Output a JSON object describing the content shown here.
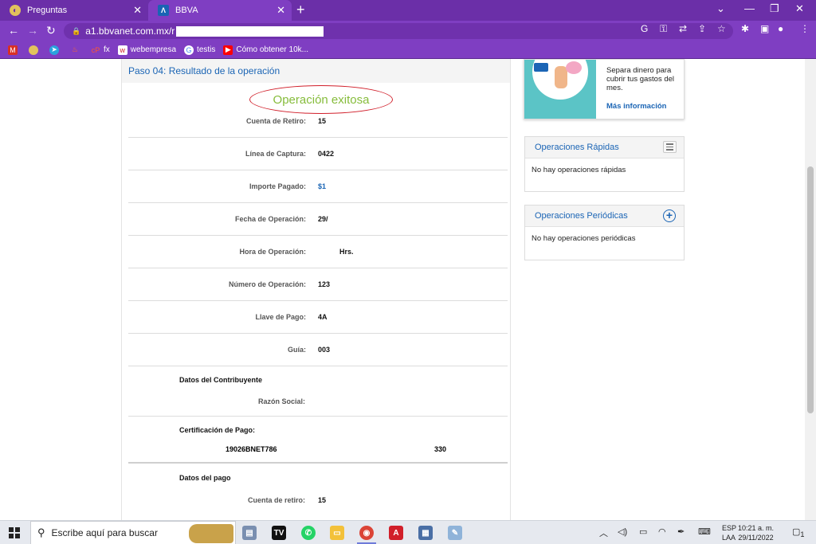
{
  "browser": {
    "tabs": [
      {
        "title": "Preguntas",
        "icon": "egg-icon"
      },
      {
        "title": "BBVA",
        "icon": "bbva-icon"
      }
    ],
    "url": "a1.bbvanet.com.mx/r",
    "bookmarks": [
      {
        "label": "",
        "icon": "mail-icon"
      },
      {
        "label": "",
        "icon": "egg-icon"
      },
      {
        "label": "",
        "icon": "telegram-icon"
      },
      {
        "label": "",
        "icon": "fire-icon"
      },
      {
        "label": "fx",
        "icon": "cp-icon"
      },
      {
        "label": "webempresa",
        "icon": "webempresa-icon"
      },
      {
        "label": "testis",
        "icon": "google-icon"
      },
      {
        "label": "Cómo obtener 10k...",
        "icon": "youtube-icon"
      }
    ]
  },
  "step": {
    "title": "Paso 04: Resultado de la operación",
    "success": "Operación exitosa"
  },
  "fields": [
    {
      "label": "Cuenta de Retiro:",
      "value": "15"
    },
    {
      "label": "Línea de Captura:",
      "value": "0422"
    },
    {
      "label": "Importe Pagado:",
      "value": "$1"
    },
    {
      "label": "Fecha de Operación:",
      "value": "29/"
    },
    {
      "label": "Hora de Operación:",
      "value": "Hrs."
    },
    {
      "label": "Número de Operación:",
      "value": "123"
    },
    {
      "label": "Llave de Pago:",
      "value": "4A"
    },
    {
      "label": "Guía:",
      "value": "003"
    }
  ],
  "contribuyente": {
    "title": "Datos del Contribuyente",
    "razon_label": "Razón Social:"
  },
  "certificacion": {
    "title": "Certificación de Pago:",
    "code": "19026BNET786",
    "number": "330"
  },
  "datos_pago": {
    "title": "Datos del pago",
    "cuenta_label": "Cuenta de retiro:",
    "cuenta_value": "15"
  },
  "promo": {
    "text": "Separa dinero para cubrir tus gastos del mes.",
    "link": "Más información"
  },
  "rapidas": {
    "title": "Operaciones Rápidas",
    "empty": "No hay operaciones rápidas"
  },
  "periodicas": {
    "title": "Operaciones Periódicas",
    "empty": "No hay operaciones periódicas"
  },
  "taskbar": {
    "search_placeholder": "Escribe aquí para buscar",
    "lang_top": "ESP",
    "lang_bottom": "LAA",
    "time": "10:21 a. m.",
    "date": "29/11/2022",
    "notif_count": "1"
  },
  "colors": {
    "browser_purple": "#7f3ec2",
    "bbva_blue": "#1b65b5",
    "success_green": "#86bc3b",
    "highlight_red": "#d11f2a"
  }
}
